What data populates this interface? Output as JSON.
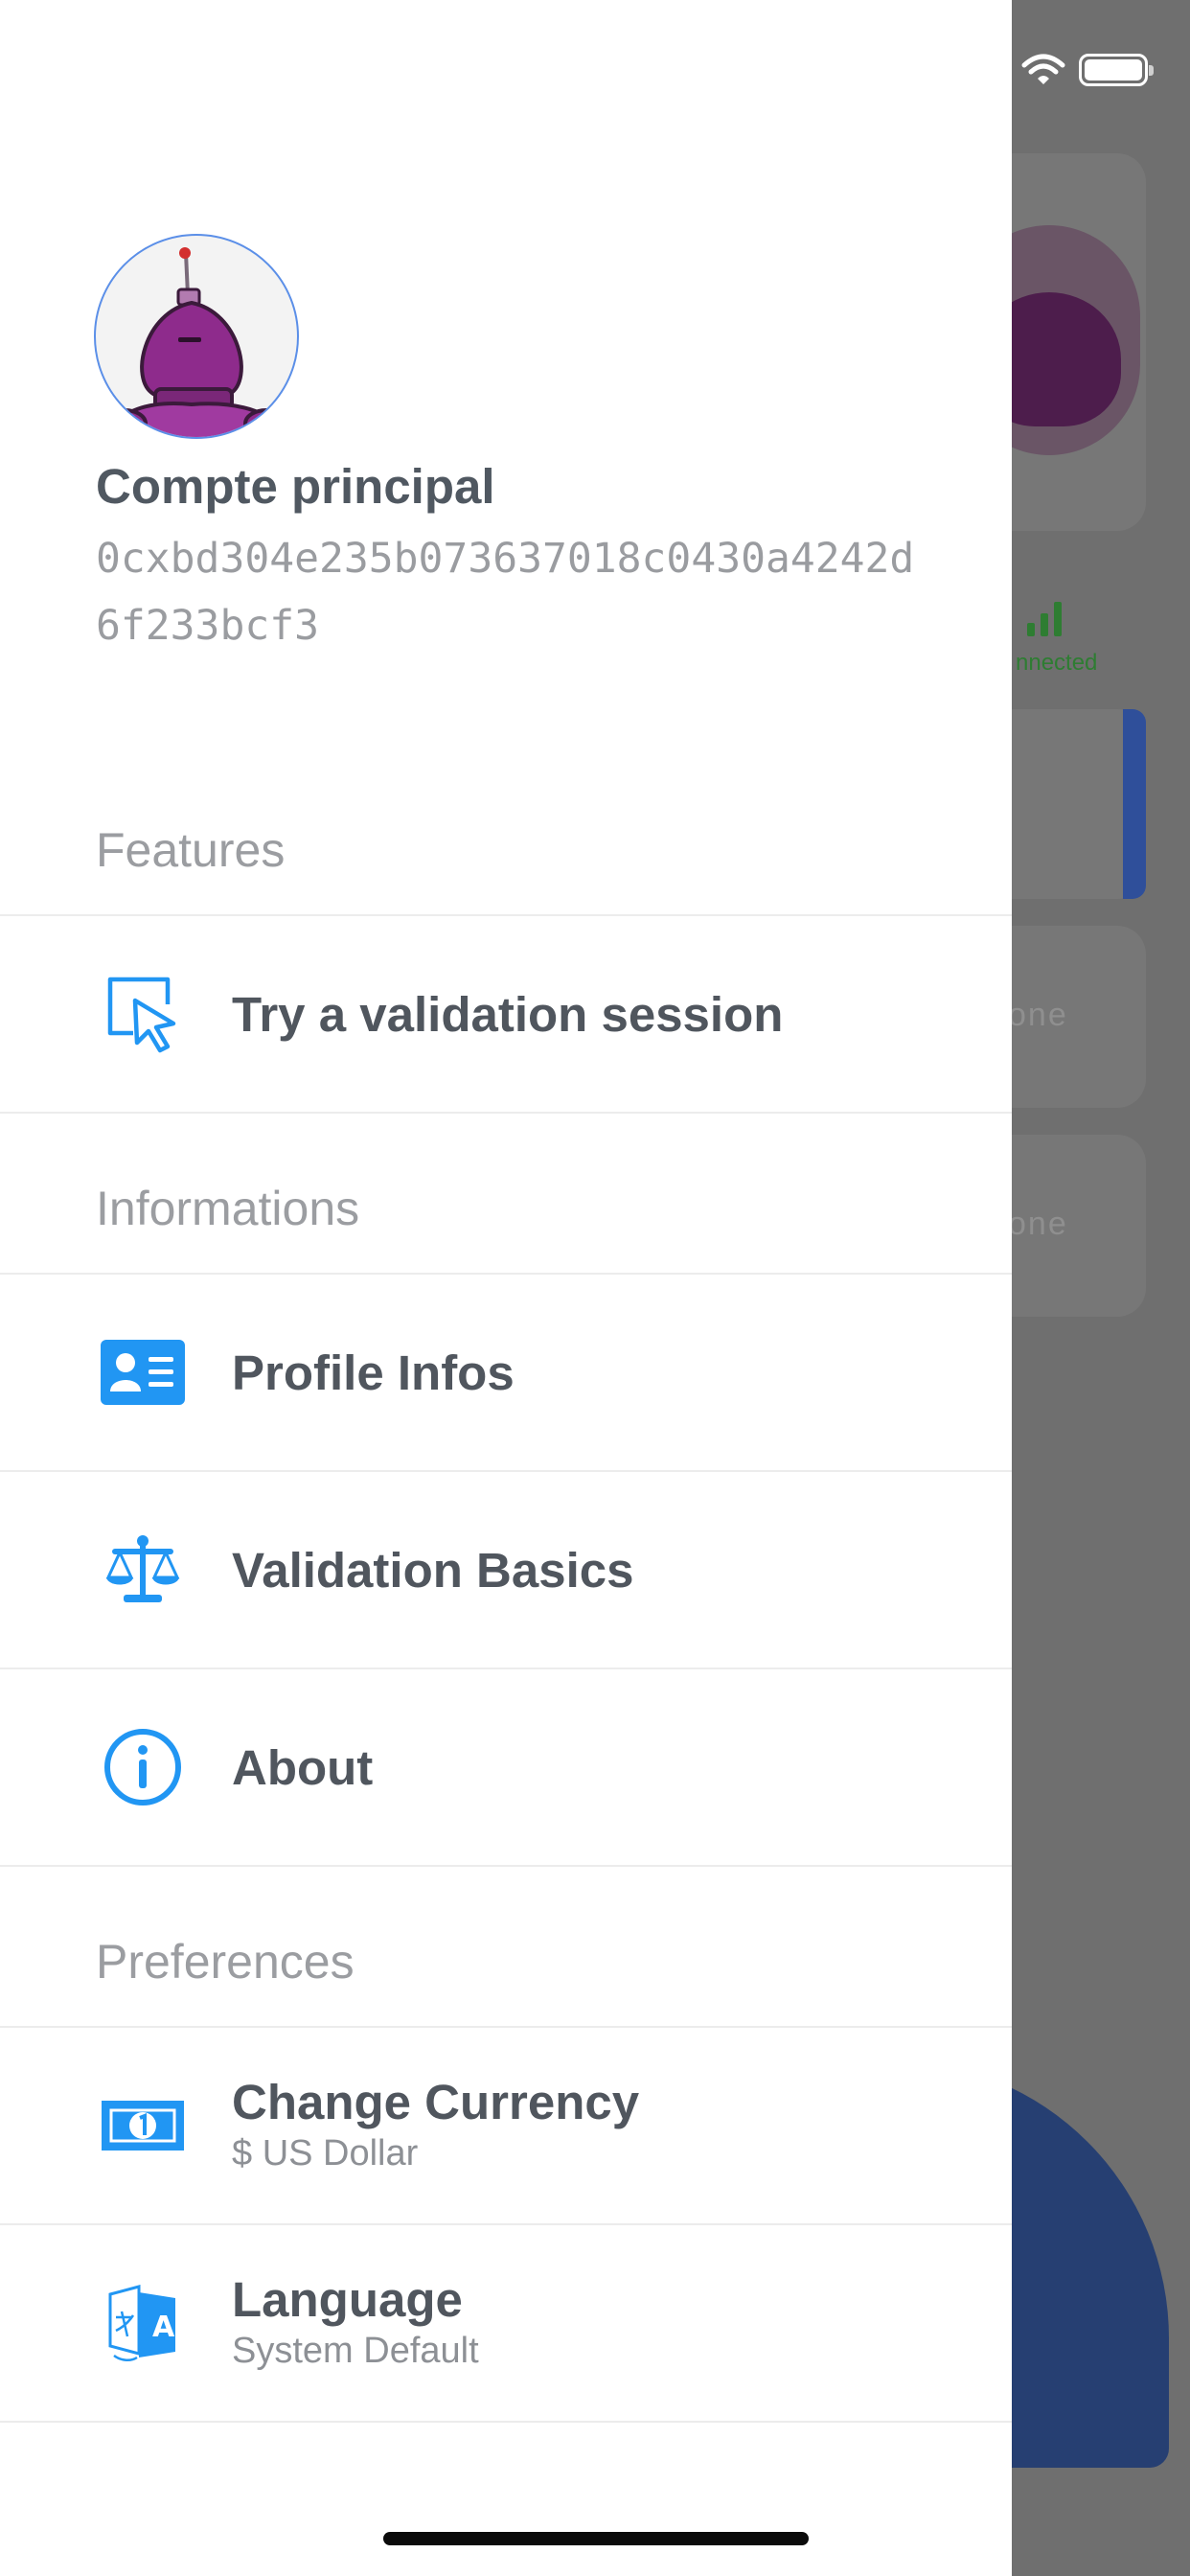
{
  "background": {
    "connected_label": "nnected",
    "row1_text": "one",
    "row2_text": "one"
  },
  "drawer": {
    "account_name": "Compte principal",
    "address": "0cxbd304e235b073637018c0430a4242d6f233bcf3",
    "sections": {
      "features": "Features",
      "informations": "Informations",
      "preferences": "Preferences"
    },
    "items": {
      "validation_session": "Try a validation session",
      "profile_infos": "Profile Infos",
      "validation_basics": "Validation Basics",
      "about": "About",
      "currency": {
        "label": "Change Currency",
        "value": "$ US Dollar"
      },
      "language": {
        "label": "Language",
        "value": "System Default"
      }
    }
  },
  "colors": {
    "accent": "#2196f3",
    "text_primary": "#50565e",
    "text_secondary": "#9b9da1",
    "overlay": "#6f6f6f"
  },
  "icons": {
    "validation_session": "cursor-click-icon",
    "profile_infos": "id-card-icon",
    "validation_basics": "scales-icon",
    "about": "info-icon",
    "currency": "banknote-icon",
    "language": "translate-icon"
  }
}
